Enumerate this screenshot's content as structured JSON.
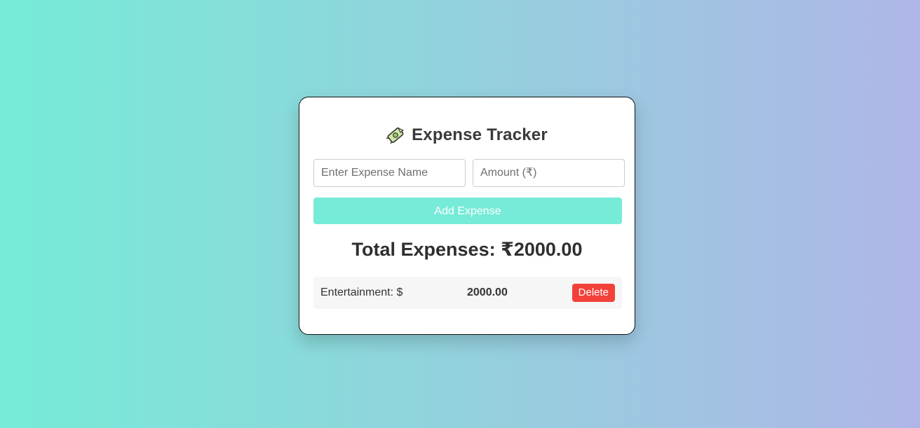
{
  "app": {
    "title": "Expense Tracker",
    "title_icon": "money-with-wings-icon"
  },
  "form": {
    "name_placeholder": "Enter Expense Name",
    "name_value": "",
    "amount_placeholder": "Amount (₹)",
    "amount_value": "",
    "add_button_label": "Add Expense"
  },
  "summary": {
    "total_label": "Total Expenses: ₹2000.00"
  },
  "expenses": [
    {
      "name": "Entertainment: $",
      "amount": "2000.00",
      "delete_label": "Delete"
    }
  ],
  "colors": {
    "accent": "#76ebd8",
    "delete": "#f2413a",
    "background_start": "#76ebd8",
    "background_end": "#afb6e7"
  }
}
